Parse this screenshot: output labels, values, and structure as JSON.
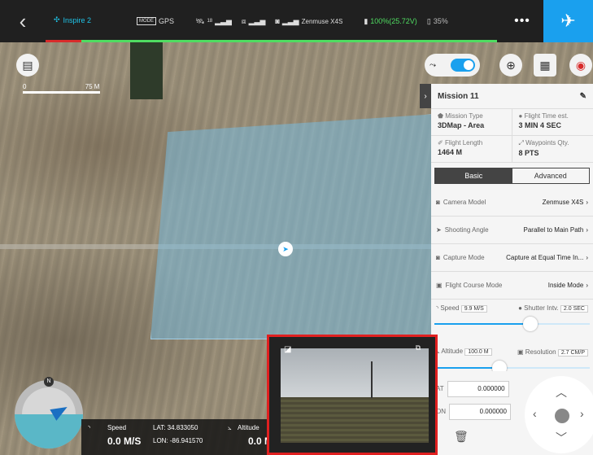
{
  "topbar": {
    "back_icon": "chevron-left-icon",
    "model": "Inspire 2",
    "mode": "GPS",
    "mode_badge": "MODE",
    "sat_count": "18",
    "camera": "Zenmuse X4S",
    "battery": "100%(25.72V)",
    "rc_battery": "35%",
    "more": "•••"
  },
  "map": {
    "scale_start": "0",
    "scale_end": "75 M"
  },
  "mission": {
    "name": "Mission 11",
    "mission_type_label": "Mission Type",
    "mission_type": "3DMap - Area",
    "flight_time_label": "Flight Time est.",
    "flight_time": "3 MIN 4 SEC",
    "flight_length_label": "Flight Length",
    "flight_length": "1464 M",
    "waypoints_label": "Waypoints Qty.",
    "waypoints": "8 PTS",
    "tab_basic": "Basic",
    "tab_advanced": "Advanced",
    "camera_model_label": "Camera Model",
    "camera_model": "Zenmuse X4S",
    "shooting_angle_label": "Shooting Angle",
    "shooting_angle": "Parallel to Main Path",
    "capture_mode_label": "Capture Mode",
    "capture_mode": "Capture at Equal Time In...",
    "course_mode_label": "Flight Course Mode",
    "course_mode": "Inside Mode",
    "speed_label": "Speed",
    "speed": "9.9 M/S",
    "shutter_label": "Shutter Intv.",
    "shutter": "2.0 SEC",
    "speed_slider_fraction": 0.62,
    "altitude_label": "Altitude",
    "altitude": "100.0 M",
    "resolution_label": "Resolution",
    "resolution": "2.7 CM/P",
    "altitude_slider_fraction": 0.42
  },
  "coords": {
    "lat_label": "AT",
    "lat": "0.000000",
    "lon_label": "ON",
    "lon": "0.000000"
  },
  "telemetry": {
    "speed_label": "Speed",
    "speed": "0.0 M/S",
    "lat": "LAT: 34.833050",
    "lon": "LON: -86.941570",
    "altitude_label": "Altitude",
    "altitude": "0.0 M"
  },
  "compass": {
    "north": "N"
  }
}
